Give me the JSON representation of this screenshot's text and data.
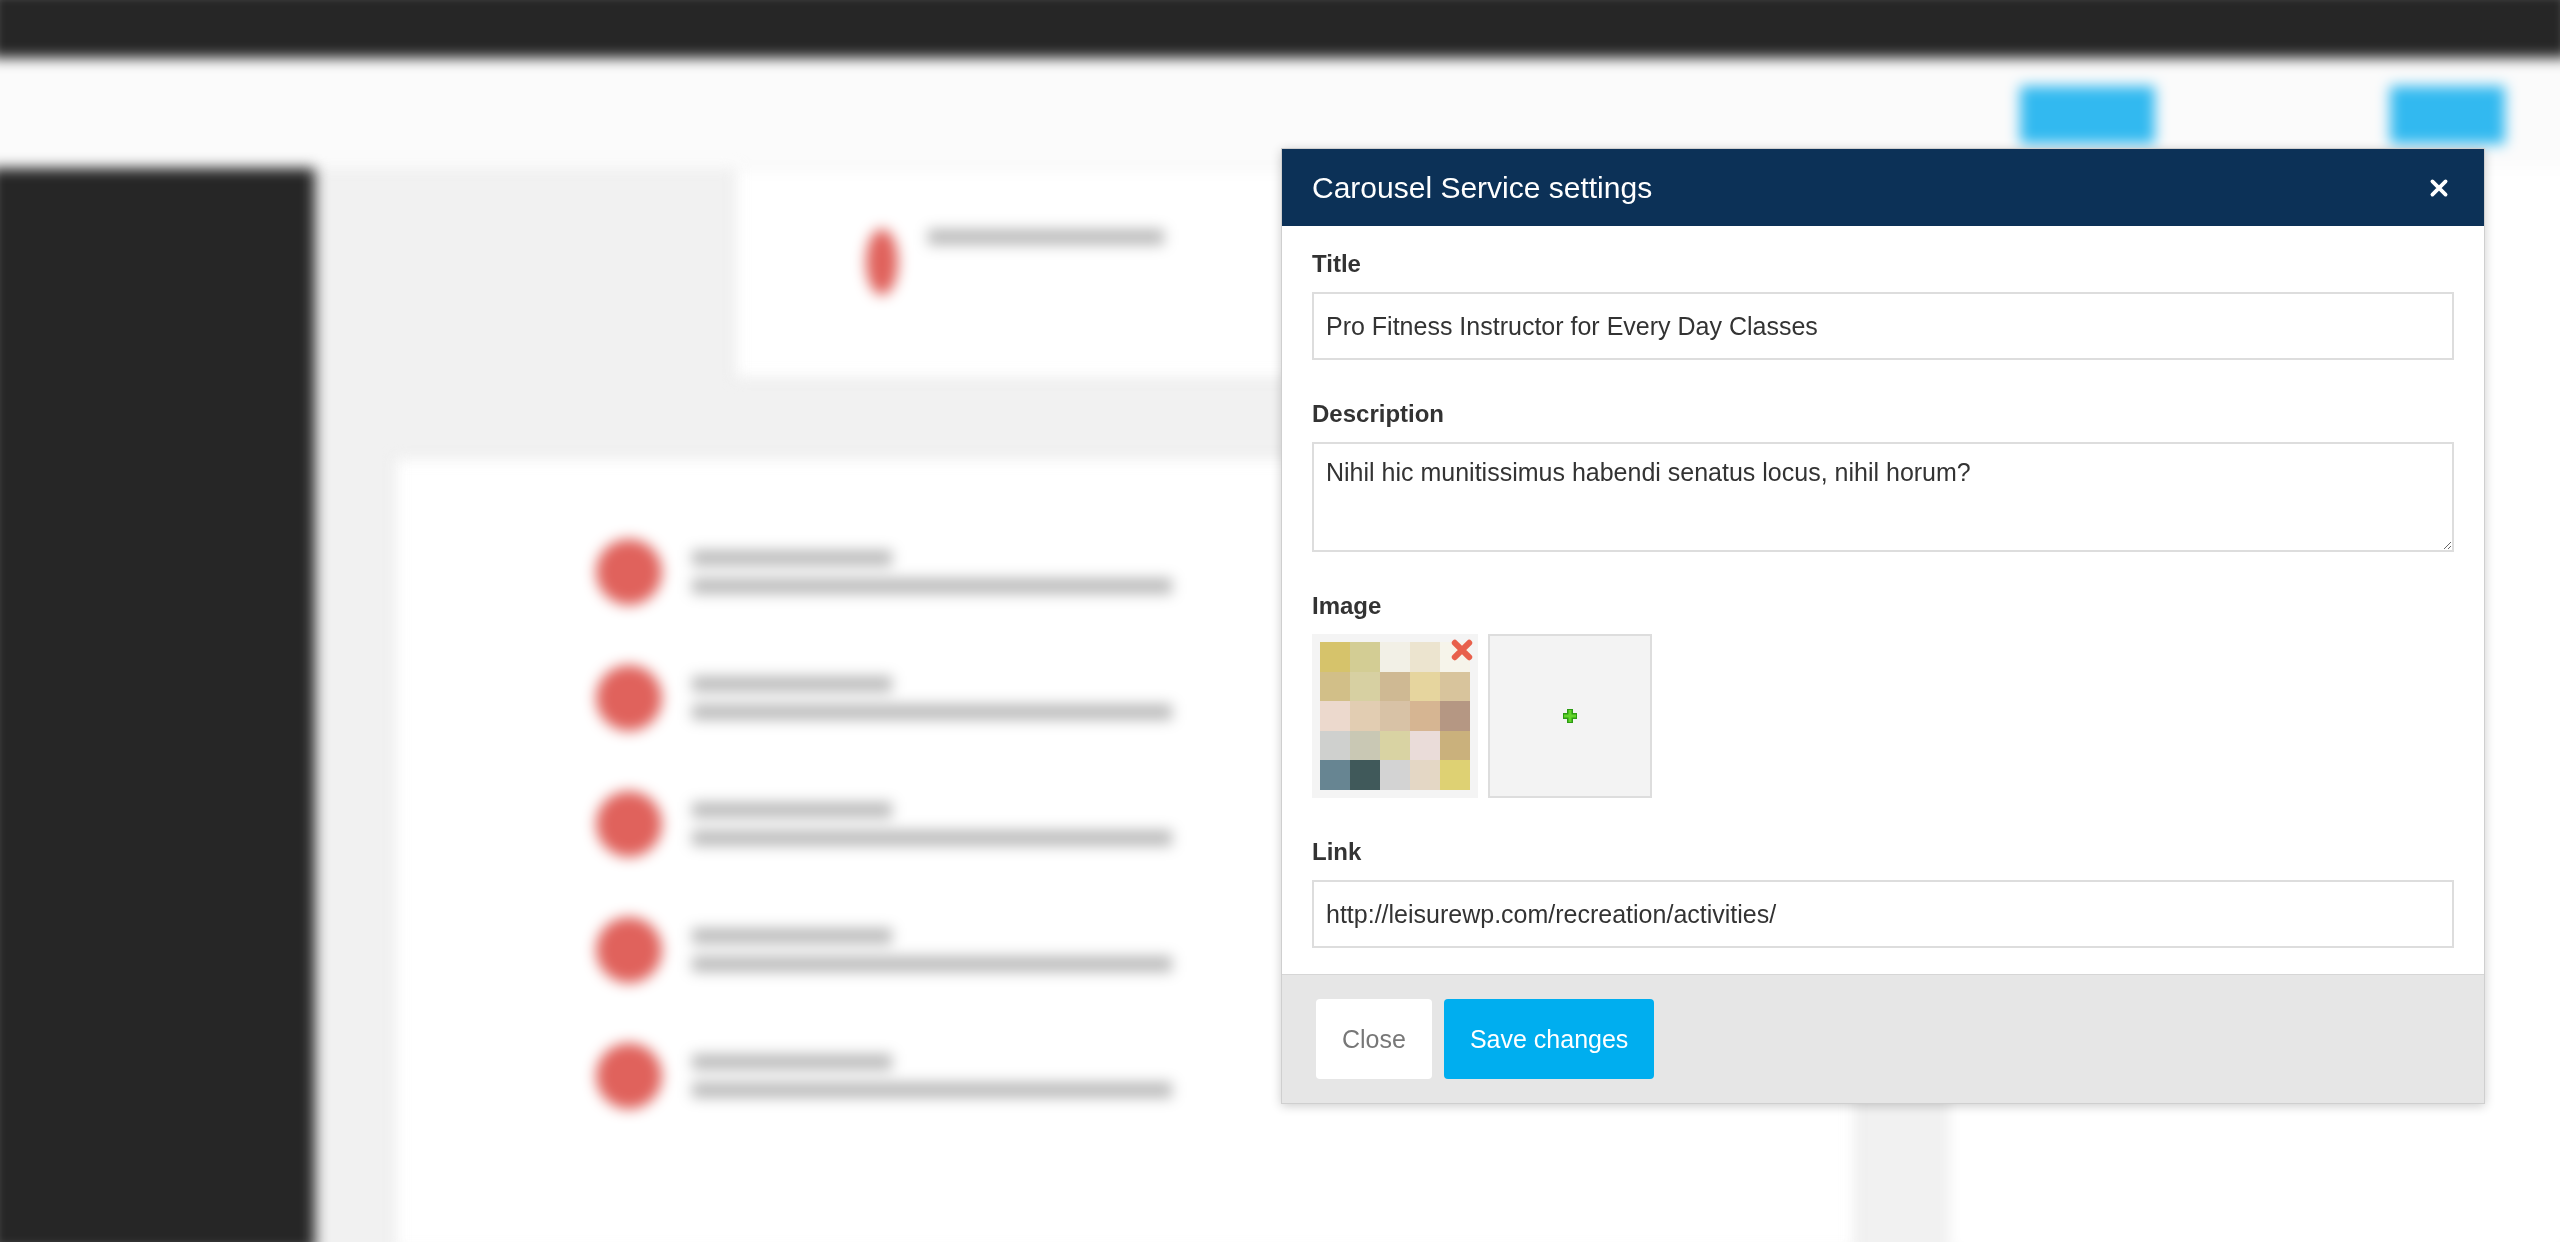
{
  "dialog": {
    "title": "Carousel Service settings",
    "fields": [
      {
        "kind": "text",
        "label": "Title",
        "value": "Pro Fitness Instructor for Every Day Classes"
      },
      {
        "kind": "textarea",
        "label": "Description",
        "value": "Nihil hic munitissimus habendi senatus locus, nihil horum?"
      },
      {
        "kind": "image",
        "label": "Image",
        "has_image": true
      },
      {
        "kind": "text",
        "label": "Link",
        "value": "http://leisurewp.com/recreation/activities/"
      }
    ],
    "buttons": [
      {
        "kind": "default",
        "label": "Close"
      },
      {
        "kind": "primary",
        "label": "Save changes"
      }
    ]
  }
}
